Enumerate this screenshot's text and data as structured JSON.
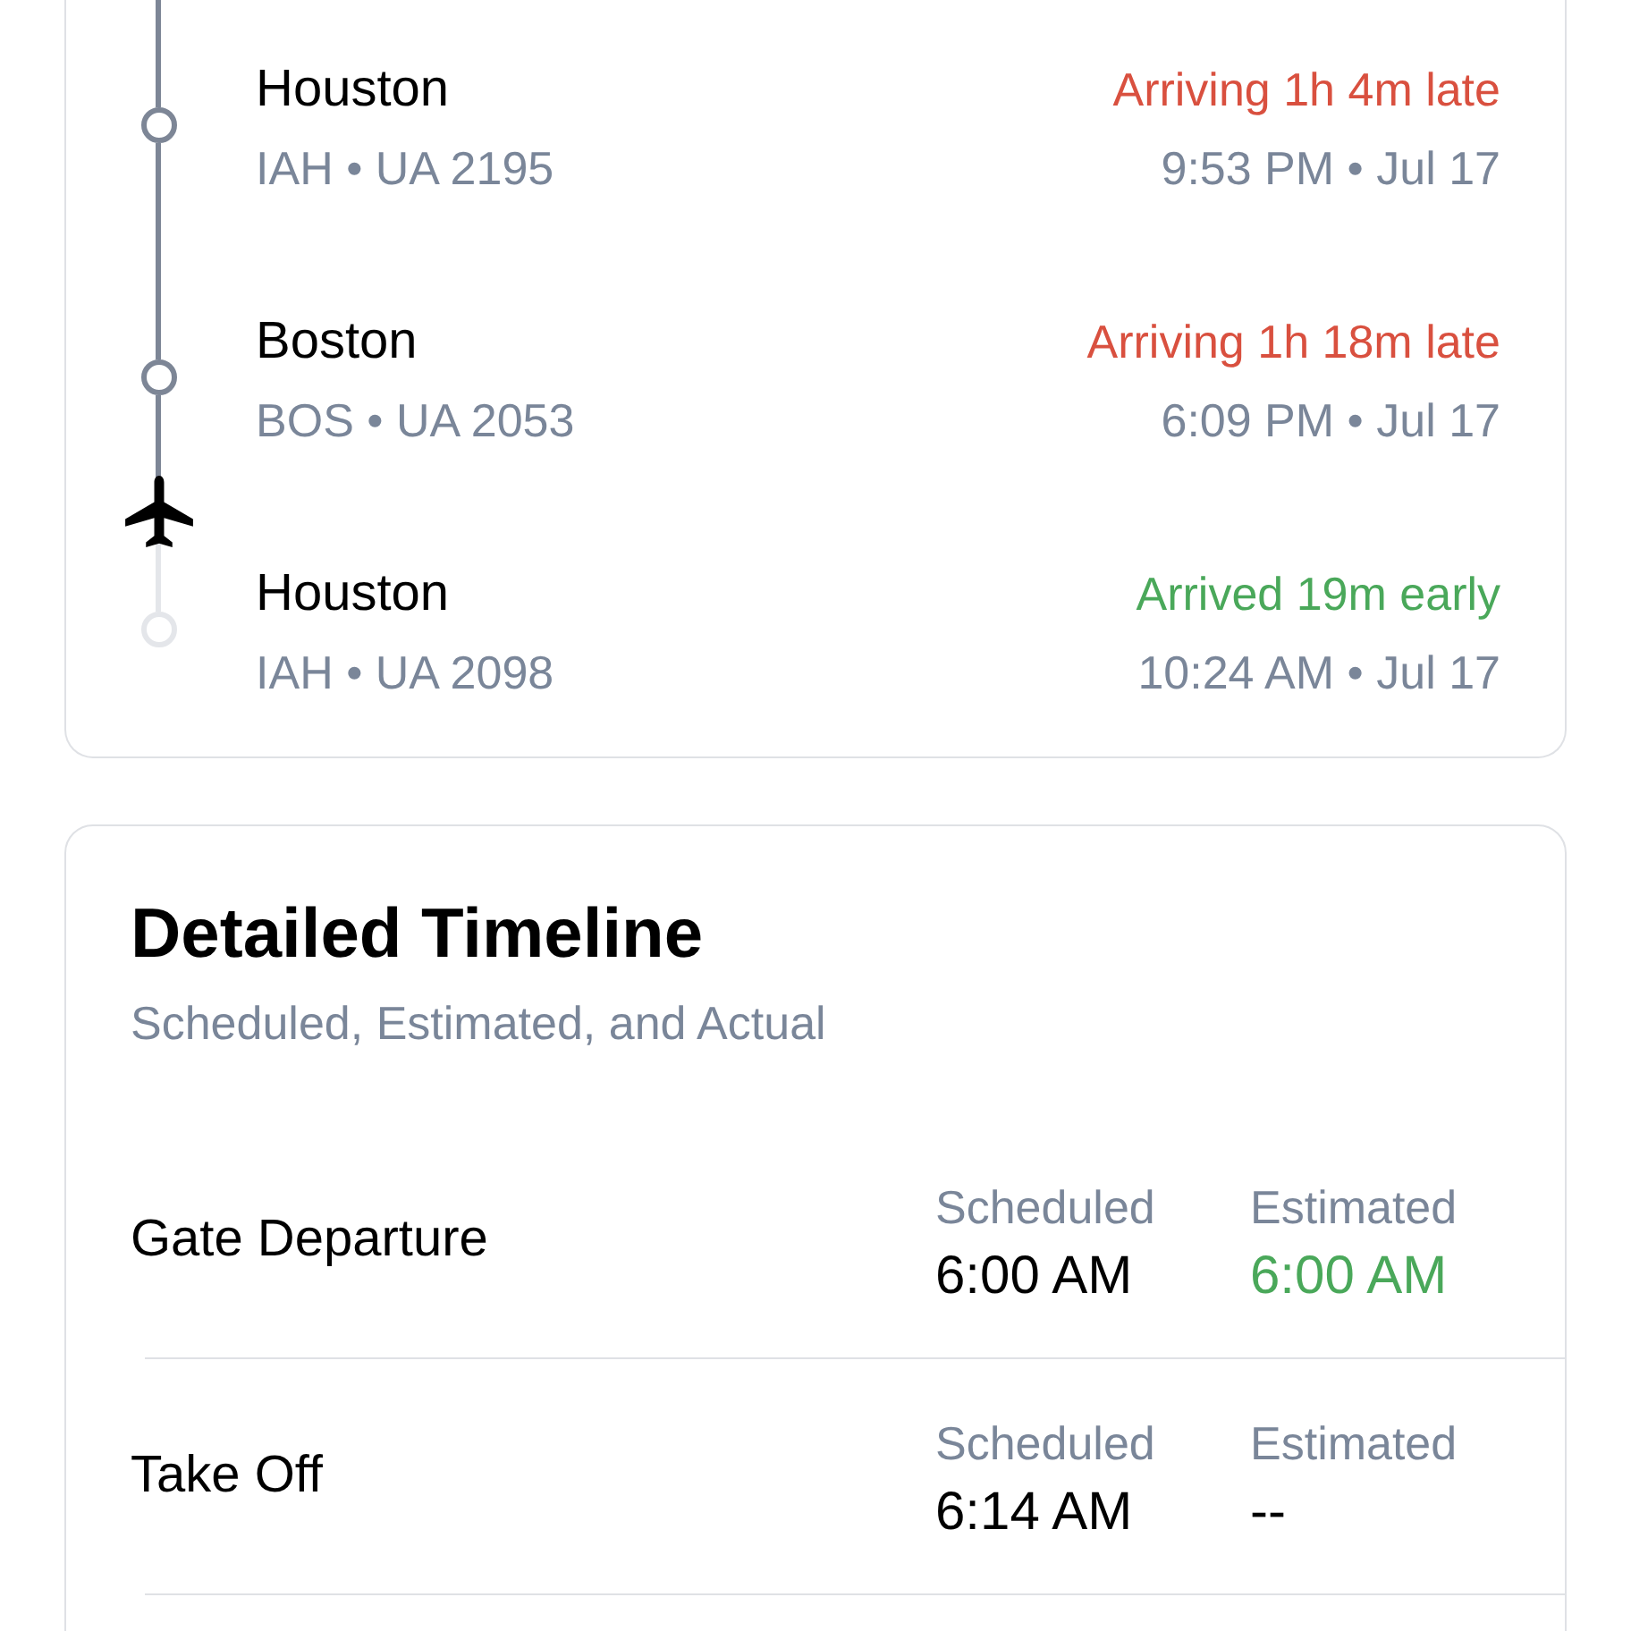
{
  "stops": [
    {
      "city": "Houston",
      "code": "IAH • UA 2195",
      "status": "Arriving 1h 4m late",
      "kind": "late",
      "time": "9:53 PM • Jul 17",
      "passed": true,
      "current": false
    },
    {
      "city": "Boston",
      "code": "BOS • UA 2053",
      "status": "Arriving 1h 18m late",
      "kind": "late",
      "time": "6:09 PM • Jul 17",
      "passed": true,
      "current": false
    },
    {
      "city": "Houston",
      "code": "IAH • UA 2098",
      "status": "Arrived 19m early",
      "kind": "early",
      "time": "10:24 AM • Jul 17",
      "passed": false,
      "current": true
    }
  ],
  "timeline": {
    "title": "Detailed Timeline",
    "subtitle": "Scheduled, Estimated, and Actual",
    "rows": [
      {
        "label": "Gate Departure",
        "columns": [
          {
            "heading": "Scheduled",
            "value": "6:00 AM",
            "kind": "plain"
          },
          {
            "heading": "Estimated",
            "value": "6:00 AM",
            "kind": "on_time"
          }
        ]
      },
      {
        "label": "Take Off",
        "columns": [
          {
            "heading": "Scheduled",
            "value": "6:14 AM",
            "kind": "plain"
          },
          {
            "heading": "Estimated",
            "value": "--",
            "kind": "plain"
          }
        ]
      }
    ]
  }
}
